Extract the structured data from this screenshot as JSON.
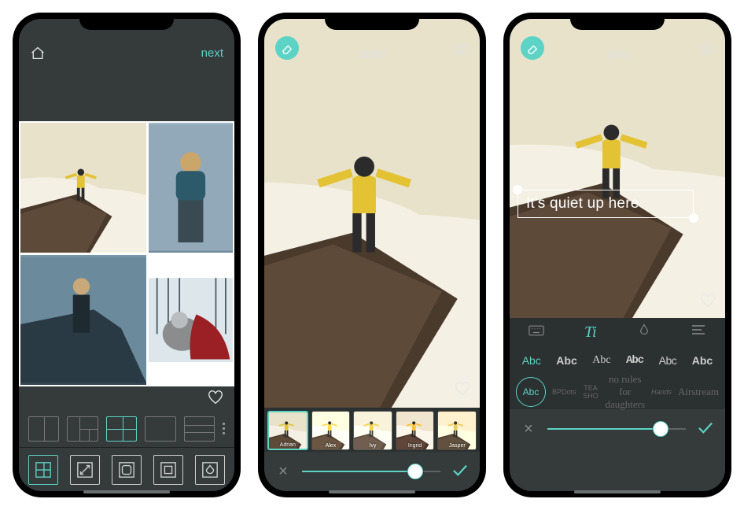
{
  "screen1": {
    "next_label": "next",
    "home_icon": "home-icon",
    "heart_icon": "heart-icon",
    "layout_icons": [
      "layout-2col",
      "layout-asym",
      "layout-grid",
      "layout-single",
      "layout-3row"
    ],
    "selected_layout": 2,
    "tool_icons": [
      "collage-tool",
      "resize-tool",
      "border-tool",
      "spacing-tool",
      "background-tool"
    ],
    "selected_tool": 0,
    "collage_images": [
      "cliff-person",
      "hiker-backpack",
      "sitting-ledge",
      "wolf-redcape-snow"
    ]
  },
  "screen2": {
    "eraser_icon": "eraser-icon",
    "title": "subtle",
    "compare_icon": "compare-icon",
    "heart_icon": "heart-icon",
    "filter_thumbs": [
      "Adrian",
      "Alex",
      "Ivy",
      "Ingrid",
      "Jasper"
    ],
    "selected_thumb": 0,
    "slider_value": 0.82,
    "cancel_icon": "close-icon",
    "confirm_icon": "check-icon"
  },
  "screen3": {
    "eraser_icon": "eraser-icon",
    "title": "type",
    "compare_icon": "compare-icon",
    "overlay_text": "It's quiet up here",
    "heart_icon": "heart-icon",
    "tabs": [
      "keyboard-tab",
      "font-tab",
      "color-tab",
      "align-tab"
    ],
    "selected_tab": 1,
    "font_samples": [
      "Abc",
      "Abc",
      "Abc",
      "Abc",
      "Abc",
      "Abc"
    ],
    "selected_font_sample": 0,
    "font_circle_label": "Abc",
    "font_names": [
      "BPDots",
      "TEA SHO",
      "no rules for daughters",
      "Hands",
      "Airstream"
    ],
    "slider_value": 0.82,
    "cancel_icon": "close-icon",
    "confirm_icon": "check-icon"
  },
  "colors": {
    "accent": "#5dd3c6",
    "bg_dark": "#353b3b",
    "panel": "#2b3030"
  }
}
